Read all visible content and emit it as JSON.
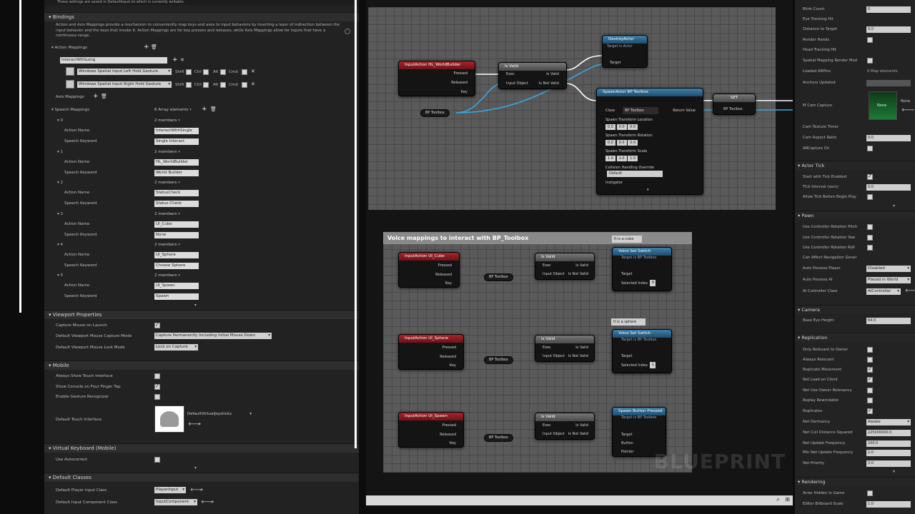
{
  "settings": {
    "top_note": "These settings are saved in DefaultInput.ini which is currently writable.",
    "bindings_header": "Bindings",
    "bindings_description": "Action and Axis Mappings provide a mechanism to conveniently map keys and axes to input behaviors by inserting a layer of indirection between the input behavior and the keys that invoke it. Action Mappings are for key presses and releases, while Axis Mappings allow for inputs that have a continuous range.",
    "action_mappings_label": "Action Mappings",
    "action_name": "InteractWithLong",
    "gesture_left": "Windows Spatial Input Left Hold Gesture",
    "gesture_right": "Windows Spatial Input Right Hold Gesture",
    "modifiers": [
      "Shift",
      "Ctrl",
      "Alt",
      "Cmd"
    ],
    "axis_mappings_label": "Axis Mappings",
    "speech_mappings_label": "Speech Mappings",
    "speech_mappings_count": "6 Array elements",
    "members_label": "2 members",
    "action_name_label": "Action Name",
    "speech_keyword_label": "Speech Keyword",
    "speech": [
      {
        "index": "0",
        "action": "InteractWithSingle",
        "keyword": "Single Interact"
      },
      {
        "index": "1",
        "action": "HL_WorldBuilder",
        "keyword": "World Builder"
      },
      {
        "index": "2",
        "action": "StatusCheck",
        "keyword": "Status Check"
      },
      {
        "index": "3",
        "action": "UI_Cube",
        "keyword": "None"
      },
      {
        "index": "4",
        "action": "UI_Sphere",
        "keyword": "Choose Sphere"
      },
      {
        "index": "5",
        "action": "UI_Spawn",
        "keyword": "Spawn"
      }
    ],
    "viewport_header": "Viewport Properties",
    "capture_mouse_label": "Capture Mouse on Launch",
    "capture_mode_label": "Default Viewport Mouse Capture Mode",
    "capture_mode_value": "Capture Permanently Including Initial Mouse Down",
    "lock_mode_label": "Default Viewport Mouse Lock Mode",
    "lock_mode_value": "Lock on Capture",
    "mobile_header": "Mobile",
    "always_touch_label": "Always Show Touch Interface",
    "show_console_label": "Show Console on Four Finger Tap",
    "gesture_recognizer_label": "Enable Gesture Recognizer",
    "touch_interface_label": "Default Touch Interface",
    "touch_interface_value": "DefaultVirtualJoysticks",
    "vkb_header": "Virtual Keyboard (Mobile)",
    "autocorrect_label": "Use Autocorrect",
    "default_classes_header": "Default Classes",
    "player_input_label": "Default Player Input Class",
    "player_input_value": "PlayerInput",
    "input_component_label": "Default Input Component Class",
    "input_component_value": "InputComponent"
  },
  "graph": {
    "top_nodes": {
      "input_action": "InputAction HL_WorldBuilder",
      "pressed": "Pressed",
      "released": "Released",
      "key": "Key",
      "is_valid": "Is Valid",
      "exec": "Exec",
      "input_object": "Input Object",
      "valid_out": "Is Valid",
      "not_valid_out": "Is Not Valid",
      "destroy_actor": "DestroyActor",
      "destroy_target_note": "Target is Actor",
      "target": "Target",
      "spawn_actor": "SpawnActor BP Toolbox",
      "class_label": "Class",
      "class_value": "BP Toolbox",
      "return_value": "Return Value",
      "spawn_location": "Spawn Transform Location",
      "spawn_rotation": "Spawn Transform Rotation",
      "spawn_scale": "Spawn Transform Scale",
      "vec_zero": "0.0",
      "vec_one": "1.0",
      "collision_label": "Collision Handling Override",
      "collision_value": "Default",
      "instigator": "Instigator",
      "set": "SET",
      "bp_toolbox": "BP Toolbox"
    },
    "comment_title": "Voice mappings to interact with BP_Toolbox",
    "tag_cube": "It is a cube",
    "tag_sphere": "It is a sphere",
    "voice_nodes": [
      {
        "action": "InputAction UI_Cube",
        "func": "Voice Set Switch",
        "sub": "Target is BP Toolbox",
        "extra": "Selected Index",
        "extra_val": "0"
      },
      {
        "action": "InputAction UI_Sphere",
        "func": "Voice Set Switch",
        "sub": "Target is BP Toolbox",
        "extra": "Selected Index",
        "extra_val": "1"
      },
      {
        "action": "InputAction UI_Spawn",
        "func": "Spawn Button Pressed",
        "sub": "Target is BP Toolbox",
        "extra": "Button",
        "extra2": "Pointer"
      }
    ],
    "watermark": "BLUEPRINT"
  },
  "details": {
    "rows_top": [
      {
        "label": "Blink Count",
        "value": "0"
      },
      {
        "label": "Eye Tracking Hit",
        "value": ""
      },
      {
        "label": "Distance to Target",
        "value": "0.0"
      },
      {
        "label": "Render Hands",
        "value": ""
      },
      {
        "label": "Head Tracking Hit",
        "value": ""
      },
      {
        "label": "Spatial Mapping Render Mod",
        "value": ""
      },
      {
        "label": "Loaded ARPins",
        "value": "0 Map elements"
      },
      {
        "label": "Anchors Updated",
        "value": ""
      }
    ],
    "capture_label": "M Cam Capture",
    "capture_value": "None",
    "texture_label": "Cam Texture Timer",
    "aspect_label": "Cam Aspect Ratio",
    "aspect_value": "0.0",
    "ar_capture_label": "ARCapture On",
    "actor_tick_header": "Actor Tick",
    "start_tick_label": "Start with Tick Enabled",
    "tick_interval_label": "Tick Interval (secs)",
    "tick_interval_value": "0.0",
    "allow_tick_label": "Allow Tick Before Begin Play",
    "pawn_header": "Pawn",
    "pawn_rows": [
      "Use Controller Rotation Pitch",
      "Use Controller Rotation Yaw",
      "Use Controller Rotation Roll",
      "Can Affect Navigation Gener"
    ],
    "auto_player_label": "Auto Possess Player",
    "auto_player_value": "Disabled",
    "auto_ai_label": "Auto Possess AI",
    "auto_ai_value": "Placed in World",
    "ai_class_label": "AI Controller Class",
    "ai_class_value": "AIController",
    "camera_header": "Camera",
    "eye_height_label": "Base Eye Height",
    "eye_height_value": "64.0",
    "replication_header": "Replication",
    "rep_rows": [
      "Only Relevant to Owner",
      "Always Relevant",
      "Replicate Movement",
      "Net Load on Client",
      "Net Use Owner Relevancy",
      "Replay Rewindable",
      "Replicates"
    ],
    "dormancy_label": "Net Dormancy",
    "dormancy_value": "Awake",
    "cull_label": "Net Cull Distance Squared",
    "cull_value": "225000000.0",
    "freq_label": "Net Update Frequency",
    "freq_value": "100.0",
    "min_freq_label": "Min Net Update Frequency",
    "min_freq_value": "2.0",
    "priority_label": "Net Priority",
    "priority_value": "3.0",
    "rendering_header": "Rendering",
    "hidden_label": "Actor Hidden In Game",
    "billboard_label": "Editor Billboard Scale",
    "billboard_value": "1.0"
  }
}
